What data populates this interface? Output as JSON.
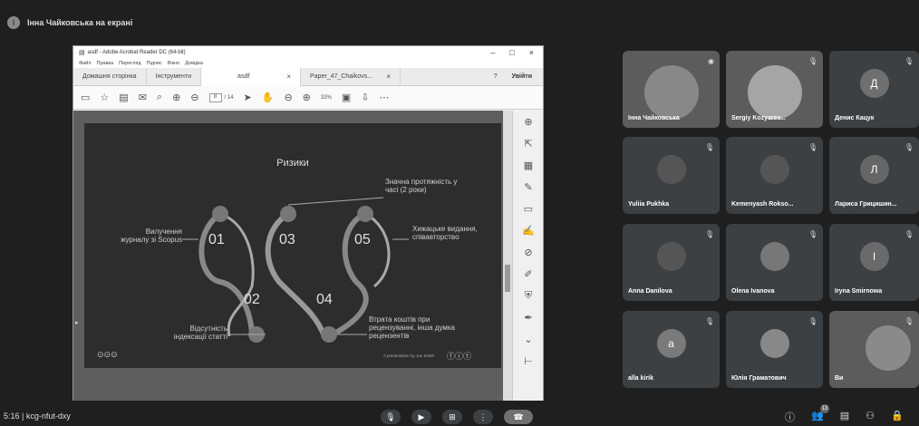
{
  "banner": {
    "title": "Інна Чайковська на екрані"
  },
  "reader": {
    "window_title": "asdf - Adobe Acrobat Reader DC (64-bit)",
    "menu": [
      "Файл",
      "Правка",
      "Перегляд",
      "Підпис",
      "Вікно",
      "Довідка"
    ],
    "tabs": [
      {
        "label": "Домашня сторінка"
      },
      {
        "label": "Інструменти"
      },
      {
        "label": "asdf"
      },
      {
        "label": "Paper_47_Chaikovs..."
      }
    ],
    "login": "Увійти",
    "page_current": "8",
    "page_total": "/ 14",
    "zoom": "33%"
  },
  "slide": {
    "title": "Ризики",
    "items": [
      {
        "num": "01",
        "label": "Вилучення журналу зі Scopus"
      },
      {
        "num": "02",
        "label": "Відсутність індексації статті"
      },
      {
        "num": "03",
        "label": "Значна протяжність у часі (2 роки)"
      },
      {
        "num": "04",
        "label": "Втрата коштів при рецензуванні, інша думка рецензентів"
      },
      {
        "num": "05",
        "label": "Хижацьке видання, співавторство"
      }
    ],
    "footer": "A presentation by Joe Smith"
  },
  "participants": [
    {
      "name": "Інна Чайковська",
      "initial": "",
      "color": "#7a7a7a",
      "video": true
    },
    {
      "name": "Sergiy Kozyarev...",
      "initial": "",
      "color": "#9a9a9a",
      "video": true
    },
    {
      "name": "Денис Кацук",
      "initial": "Д",
      "color": "#6f6f6f",
      "video": false
    },
    {
      "name": "Yuliia Pukhka",
      "initial": "",
      "color": "#555",
      "video": false
    },
    {
      "name": "Kemenyash Rokso...",
      "initial": "",
      "color": "#555",
      "video": false
    },
    {
      "name": "Лариса Грицишин...",
      "initial": "Л",
      "color": "#666",
      "video": false
    },
    {
      "name": "Anna Danilova",
      "initial": "",
      "color": "#555",
      "video": false
    },
    {
      "name": "Olena Ivanova",
      "initial": "",
      "color": "#777",
      "video": false
    },
    {
      "name": "Iryna Smirnowa",
      "initial": "I",
      "color": "#6a6a6a",
      "video": false
    },
    {
      "name": "alla kirik",
      "initial": "a",
      "color": "#7a7a7a",
      "video": false
    },
    {
      "name": "Юлія Граматович",
      "initial": "",
      "color": "#888",
      "video": false
    },
    {
      "name": "Ви",
      "initial": "",
      "color": "#8a8a8a",
      "video": true
    }
  ],
  "meeting": {
    "info": "5:16  |  kcg-nfut-dxy",
    "participant_count": "13"
  }
}
